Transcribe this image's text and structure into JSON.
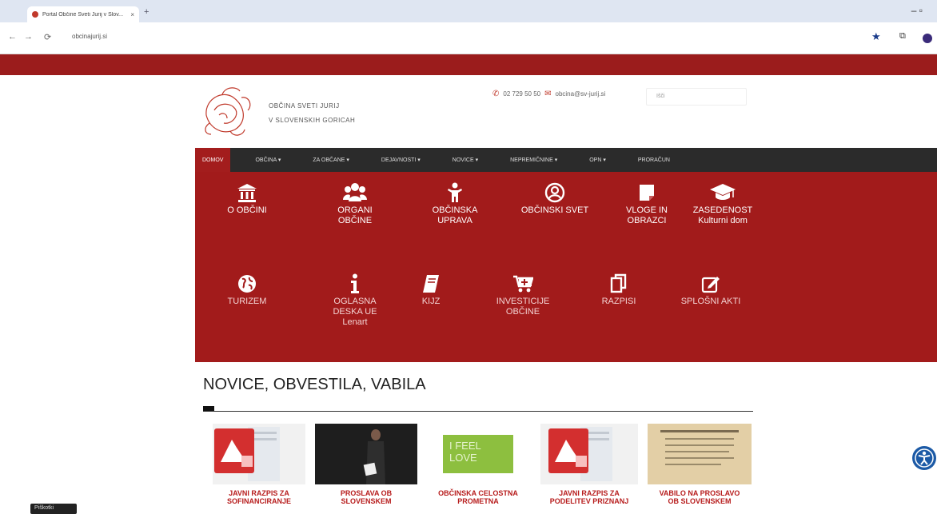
{
  "browser": {
    "tab_title": "Portal Občine Sveti Jurij v Slov...",
    "tab_close": "×",
    "new_tab": "+",
    "window_controls": "–   ▫",
    "back": "←",
    "forward": "→",
    "reload": "⟳",
    "url": "obcinajurij.si"
  },
  "header": {
    "municipality_line1": "OBČINA SVETI JURIJ",
    "municipality_line2": "V SLOVENSKIH GORICAH",
    "phone": "02 729 50 50",
    "email": "obcina@sv-jurij.si",
    "search_placeholder": "Išči"
  },
  "nav": {
    "items": [
      {
        "label": "DOMOV"
      },
      {
        "label": "OBČINA ▾"
      },
      {
        "label": "ZA OBČANE ▾"
      },
      {
        "label": "DEJAVNOSTI ▾"
      },
      {
        "label": "NOVICE ▾"
      },
      {
        "label": "NEPREMIČNINE ▾"
      },
      {
        "label": "OPN ▾"
      },
      {
        "label": "PRORAČUN"
      }
    ]
  },
  "quick_links": [
    {
      "icon": "institution-icon",
      "line1": "O OBČINI",
      "line2": "",
      "line3": ""
    },
    {
      "icon": "group-icon",
      "line1": "ORGANI",
      "line2": "OBČINE",
      "line3": ""
    },
    {
      "icon": "person-icon",
      "line1": "OBČINSKA",
      "line2": "UPRAVA",
      "line3": ""
    },
    {
      "icon": "user-circle-icon",
      "line1": "OBČINSKI SVET",
      "line2": "",
      "line3": ""
    },
    {
      "icon": "document-icon",
      "line1": "VLOGE IN",
      "line2": "OBRAZCI",
      "line3": ""
    },
    {
      "icon": "graduation-cap-icon",
      "line1": "ZASEDENOST",
      "line2": "Kulturni dom",
      "line3": ""
    },
    {
      "icon": "globe-icon",
      "line1": "TURIZEM",
      "line2": "",
      "line3": ""
    },
    {
      "icon": "info-icon",
      "line1": "OGLASNA",
      "line2": "DESKA UE",
      "line3": "Lenart"
    },
    {
      "icon": "book-icon",
      "line1": "KIJZ",
      "line2": "",
      "line3": ""
    },
    {
      "icon": "cart-icon",
      "line1": "INVESTICIJE",
      "line2": "OBČINE",
      "line3": ""
    },
    {
      "icon": "copy-icon",
      "line1": "RAZPISI",
      "line2": "",
      "line3": ""
    },
    {
      "icon": "edit-icon",
      "line1": "SPLOŠNI AKTI",
      "line2": "",
      "line3": ""
    }
  ],
  "news": {
    "heading": "NOVICE, OBVESTILA, VABILA",
    "cards": [
      {
        "line1": "JAVNI RAZPIS ZA",
        "line2": "SOFINANCIRANJE"
      },
      {
        "line1": "PROSLAVA OB",
        "line2": "SLOVENSKEM"
      },
      {
        "line1": "OBČINSKA CELOSTNA",
        "line2": "PROMETNA"
      },
      {
        "line1": "JAVNI RAZPIS ZA",
        "line2": "PODELITEV PRIZNANJ"
      },
      {
        "line1": "VABILO NA PROSLAVO",
        "line2": "OB SLOVENSKEM"
      }
    ],
    "banner_text1": "I FEEL",
    "banner_text2": "LOVE"
  },
  "cookie_label": "Piškotki",
  "colors": {
    "brand": "#a21b1b",
    "nav": "#2b2b2b",
    "caption": "#b71c1c"
  }
}
